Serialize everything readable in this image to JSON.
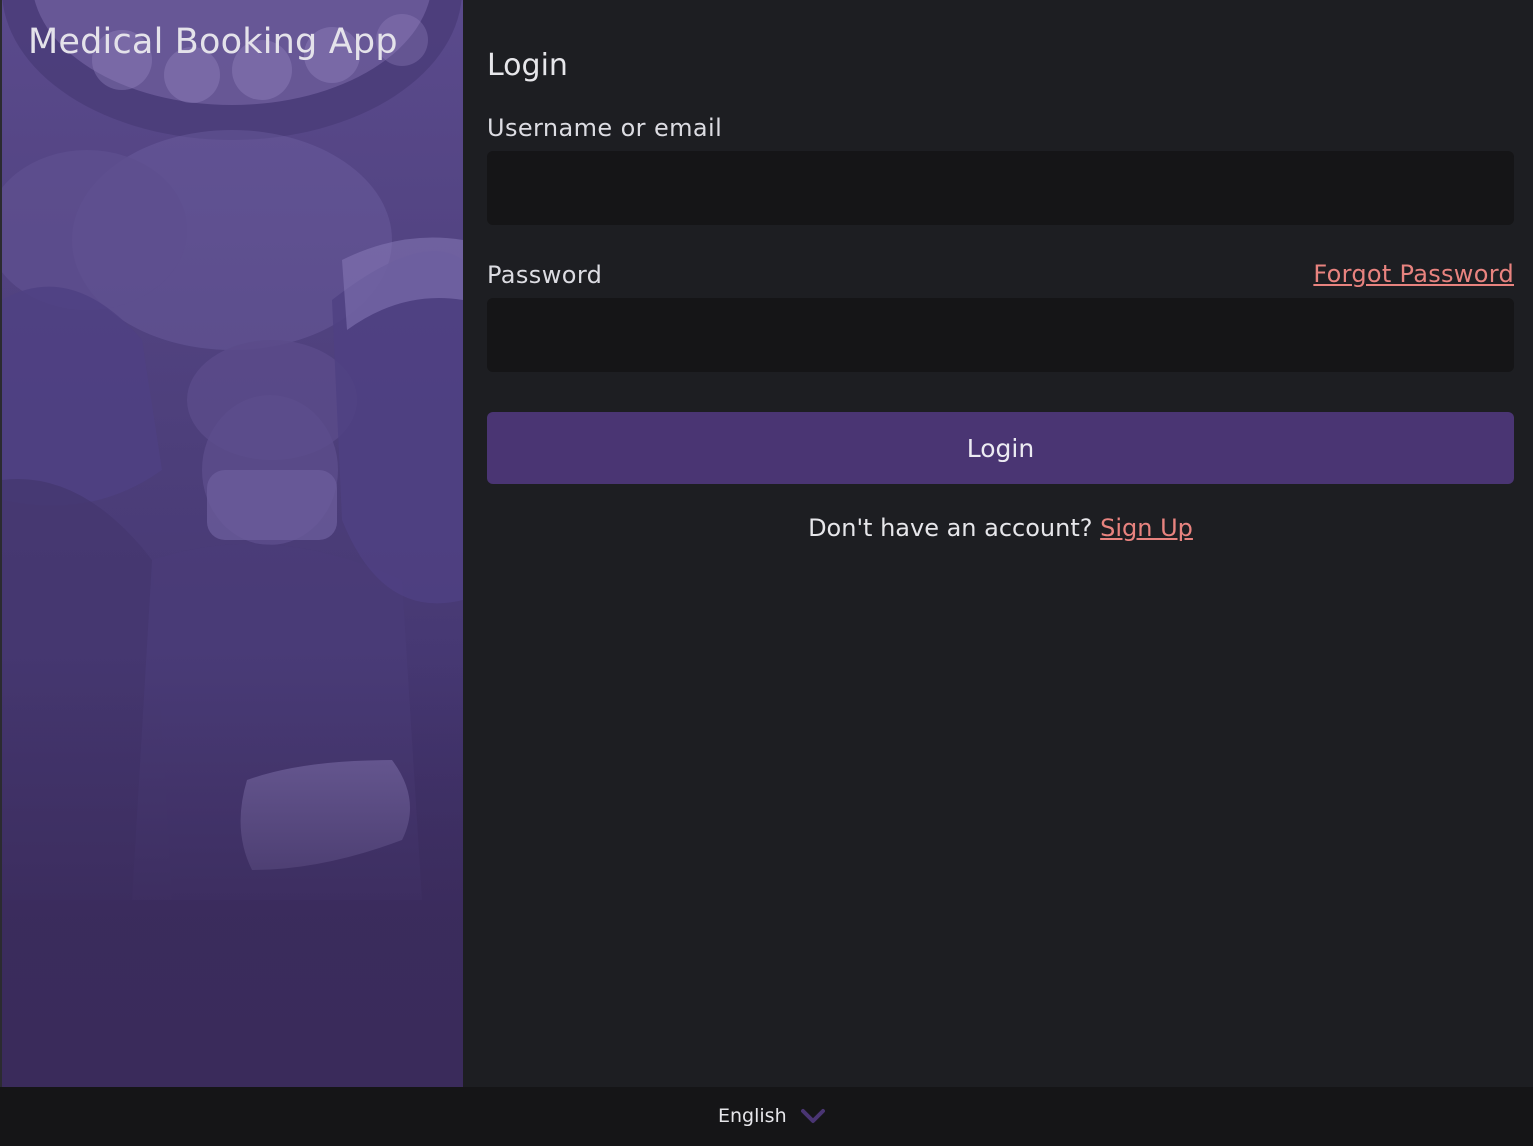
{
  "app": {
    "title": "Medical Booking App"
  },
  "login": {
    "heading": "Login",
    "username_label": "Username or email",
    "username_value": "",
    "username_placeholder": "",
    "password_label": "Password",
    "password_value": "",
    "password_placeholder": "",
    "forgot_password": "Forgot Password",
    "submit_label": "Login",
    "signup_prompt": "Don't have an account?",
    "signup_link": "Sign Up"
  },
  "footer": {
    "language": "English",
    "language_icon": "chevron-down-icon"
  },
  "colors": {
    "accent": "#4a3573",
    "link": "#e8837f",
    "background": "#1d1e22",
    "input_background": "#151517",
    "side_panel": "#4d3f7b"
  }
}
